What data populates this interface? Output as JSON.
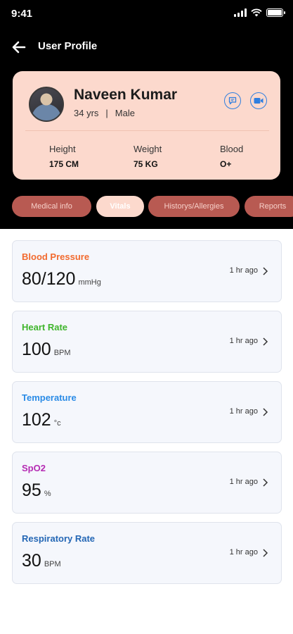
{
  "status_bar": {
    "time": "9:41"
  },
  "header": {
    "title": "User Profile"
  },
  "profile": {
    "name": "Naveen Kumar",
    "age": "34 yrs",
    "separator": "|",
    "gender": "Male",
    "stats": [
      {
        "label": "Height",
        "value": "175 CM"
      },
      {
        "label": "Weight",
        "value": "75 KG"
      },
      {
        "label": "Blood",
        "value": "O+"
      }
    ]
  },
  "tabs": [
    {
      "label": "Medical info",
      "active": false
    },
    {
      "label": "Vitals",
      "active": true
    },
    {
      "label": "Historys/Allergies",
      "active": false
    },
    {
      "label": "Reports",
      "active": false
    }
  ],
  "vitals": [
    {
      "name": "Blood Pressure",
      "value": "80/120",
      "unit": "mmHg",
      "time": "1 hr ago",
      "color": "#f26a2e"
    },
    {
      "name": "Heart Rate",
      "value": "100",
      "unit": "BPM",
      "time": "1 hr ago",
      "color": "#3fb52c"
    },
    {
      "name": "Temperature",
      "value": "102",
      "unit": "°c",
      "time": "1 hr ago",
      "color": "#2a8be6"
    },
    {
      "name": "SpO2",
      "value": "95",
      "unit": "%",
      "time": "1 hr ago",
      "color": "#b52bb3"
    },
    {
      "name": "Respiratory Rate",
      "value": "30",
      "unit": "BPM",
      "time": "1 hr ago",
      "color": "#2467b5"
    }
  ],
  "colors": {
    "accent": "#fcd9cd",
    "tab_inactive": "#b85a52",
    "icon_blue": "#2f7fe0"
  }
}
